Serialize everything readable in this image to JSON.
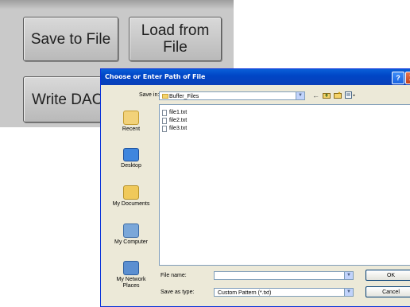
{
  "panel": {
    "save_button": "Save to File",
    "load_button": "Load from\nFile",
    "write_button": "Write DAC"
  },
  "dialog": {
    "title": "Choose or Enter Path of File",
    "help_glyph": "?",
    "close_glyph": "X",
    "save_in_label": "Save in:",
    "save_in_value": "Buffer_Files",
    "toolbar_icons": [
      "back-arrow-icon",
      "up-folder-icon",
      "new-folder-icon",
      "views-menu-icon"
    ],
    "places": [
      {
        "label": "Recent",
        "icon": "recent-icon"
      },
      {
        "label": "Desktop",
        "icon": "desktop-icon"
      },
      {
        "label": "My Documents",
        "icon": "my-documents-icon"
      },
      {
        "label": "My Computer",
        "icon": "my-computer-icon"
      },
      {
        "label": "My Network Places",
        "icon": "network-places-icon"
      }
    ],
    "files": [
      "file1.txt",
      "file2.txt",
      "file3.txt"
    ],
    "file_name_label": "File name:",
    "file_name_value": "",
    "save_type_label": "Save as type:",
    "save_type_value": "Custom Pattern (*.txt)",
    "ok_label": "OK",
    "cancel_label": "Cancel"
  }
}
